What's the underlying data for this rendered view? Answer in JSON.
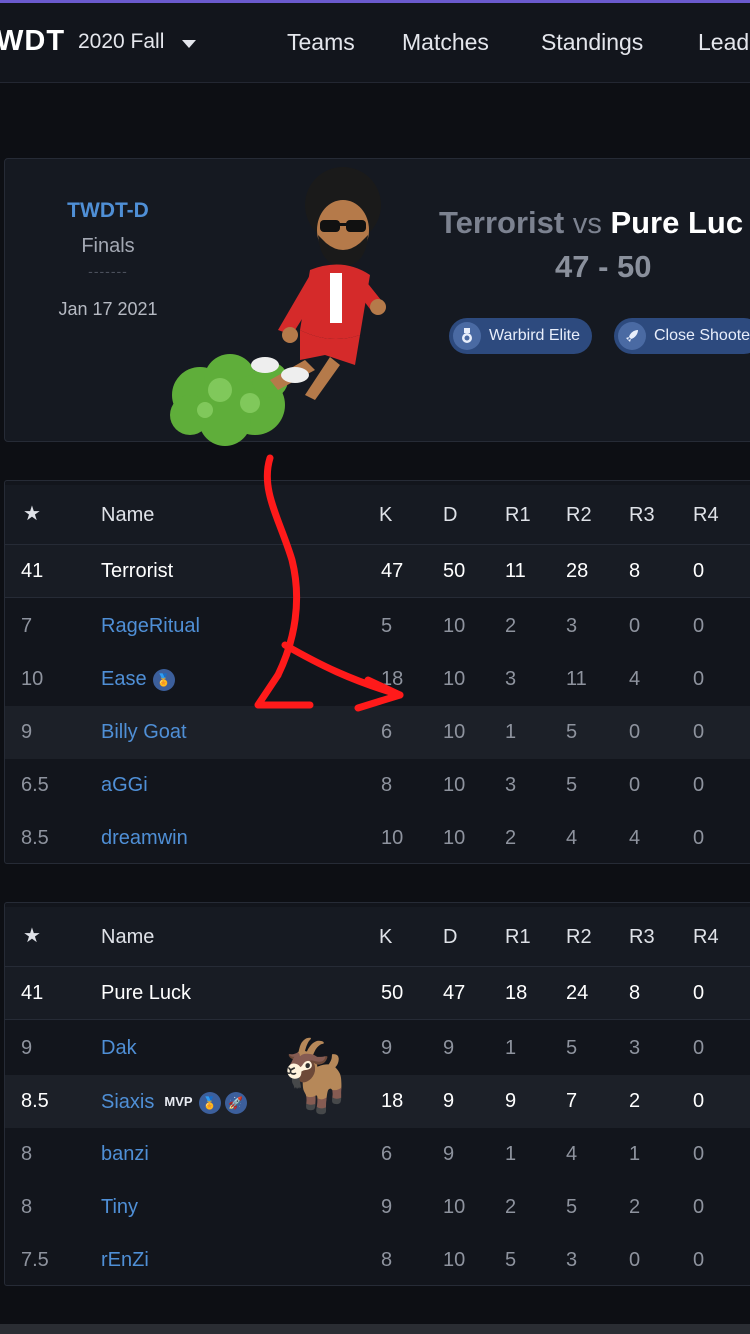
{
  "nav": {
    "brand": "WDT",
    "season": "2020 Fall",
    "links": [
      "Teams",
      "Matches",
      "Standings",
      "Lead"
    ]
  },
  "match": {
    "tournament": "TWDT-D",
    "stage": "Finals",
    "separator": "-------",
    "date": "Jan 17 2021",
    "team1": "Terrorist",
    "vs": "vs",
    "team2": "Pure Luc",
    "score": "47 - 50",
    "badges": [
      {
        "label": "Warbird Elite",
        "icon": "medal-icon"
      },
      {
        "label": "Close Shoote",
        "icon": "rocket-icon"
      }
    ]
  },
  "columns": [
    "Name",
    "K",
    "D",
    "R1",
    "R2",
    "R3",
    "R4"
  ],
  "table1": {
    "total": {
      "rating": "41",
      "name": "Terrorist",
      "k": "47",
      "d": "50",
      "r1": "11",
      "r2": "28",
      "r3": "8",
      "r4": "0"
    },
    "players": [
      {
        "rating": "7",
        "name": "RageRitual",
        "k": "5",
        "d": "10",
        "r1": "2",
        "r2": "3",
        "r3": "0",
        "r4": "0"
      },
      {
        "rating": "10",
        "name": "Ease",
        "k": "18",
        "d": "10",
        "r1": "3",
        "r2": "11",
        "r3": "4",
        "r4": "0"
      },
      {
        "rating": "9",
        "name": "Billy Goat",
        "k": "6",
        "d": "10",
        "r1": "1",
        "r2": "5",
        "r3": "0",
        "r4": "0"
      },
      {
        "rating": "6.5",
        "name": "aGGi",
        "k": "8",
        "d": "10",
        "r1": "3",
        "r2": "5",
        "r3": "0",
        "r4": "0"
      },
      {
        "rating": "8.5",
        "name": "dreamwin",
        "k": "10",
        "d": "10",
        "r1": "2",
        "r2": "4",
        "r3": "4",
        "r4": "0"
      }
    ]
  },
  "table2": {
    "total": {
      "rating": "41",
      "name": "Pure Luck",
      "k": "50",
      "d": "47",
      "r1": "18",
      "r2": "24",
      "r3": "8",
      "r4": "0"
    },
    "players": [
      {
        "rating": "9",
        "name": "Dak",
        "k": "9",
        "d": "9",
        "r1": "1",
        "r2": "5",
        "r3": "3",
        "r4": "0"
      },
      {
        "rating": "8.5",
        "name": "Siaxis",
        "mvp": "MVP",
        "k": "18",
        "d": "9",
        "r1": "9",
        "r2": "7",
        "r3": "2",
        "r4": "0"
      },
      {
        "rating": "8",
        "name": "banzi",
        "k": "6",
        "d": "9",
        "r1": "1",
        "r2": "4",
        "r3": "1",
        "r4": "0"
      },
      {
        "rating": "8",
        "name": "Tiny",
        "k": "9",
        "d": "10",
        "r1": "2",
        "r2": "5",
        "r3": "2",
        "r4": "0"
      },
      {
        "rating": "7.5",
        "name": "rEnZi",
        "k": "8",
        "d": "10",
        "r1": "5",
        "r2": "3",
        "r3": "0",
        "r4": "0"
      }
    ]
  },
  "stickers": {
    "goat": "🐐"
  },
  "colors": {
    "background": "#0d0f14",
    "accent_blue": "#4f8fd6",
    "badge_blue": "#2d4a7e",
    "arrow_red": "#ff1a1a"
  }
}
